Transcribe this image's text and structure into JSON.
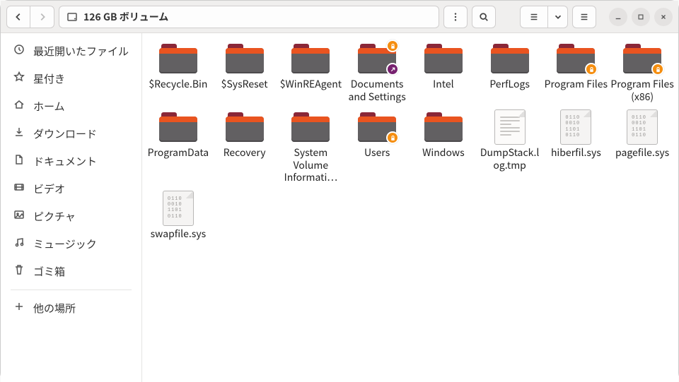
{
  "header": {
    "location_title": "126 GB ボリューム"
  },
  "sidebar": {
    "items": [
      {
        "icon": "clock",
        "label": "最近開いたファイル"
      },
      {
        "icon": "star",
        "label": "星付き"
      },
      {
        "icon": "home",
        "label": "ホーム"
      },
      {
        "icon": "download",
        "label": "ダウンロード"
      },
      {
        "icon": "document",
        "label": "ドキュメント"
      },
      {
        "icon": "video",
        "label": "ビデオ"
      },
      {
        "icon": "picture",
        "label": "ピクチャ"
      },
      {
        "icon": "music",
        "label": "ミュージック"
      },
      {
        "icon": "trash",
        "label": "ゴミ箱"
      }
    ],
    "other_places_label": "他の場所"
  },
  "content": {
    "items": [
      {
        "type": "folder",
        "label": "$Recycle.Bin"
      },
      {
        "type": "folder",
        "label": "$SysReset"
      },
      {
        "type": "folder",
        "label": "$WinREAgent"
      },
      {
        "type": "folder",
        "label": "Documents and Settings",
        "lock_top": true,
        "link": true
      },
      {
        "type": "folder",
        "label": "Intel"
      },
      {
        "type": "folder",
        "label": "PerfLogs"
      },
      {
        "type": "folder",
        "label": "Program Files",
        "lock_bottom": true
      },
      {
        "type": "folder",
        "label": "Program Files (x86)",
        "lock_bottom": true
      },
      {
        "type": "folder",
        "label": "ProgramData"
      },
      {
        "type": "folder",
        "label": "Recovery"
      },
      {
        "type": "folder",
        "label": "System Volume Informati…"
      },
      {
        "type": "folder",
        "label": "Users",
        "lock_bottom": true
      },
      {
        "type": "folder",
        "label": "Windows"
      },
      {
        "type": "textfile",
        "label": "DumpStack.log.tmp"
      },
      {
        "type": "sysfile",
        "label": "hiberfil.sys"
      },
      {
        "type": "sysfile",
        "label": "pagefile.sys"
      },
      {
        "type": "sysfile",
        "label": "swapfile.sys"
      }
    ]
  }
}
